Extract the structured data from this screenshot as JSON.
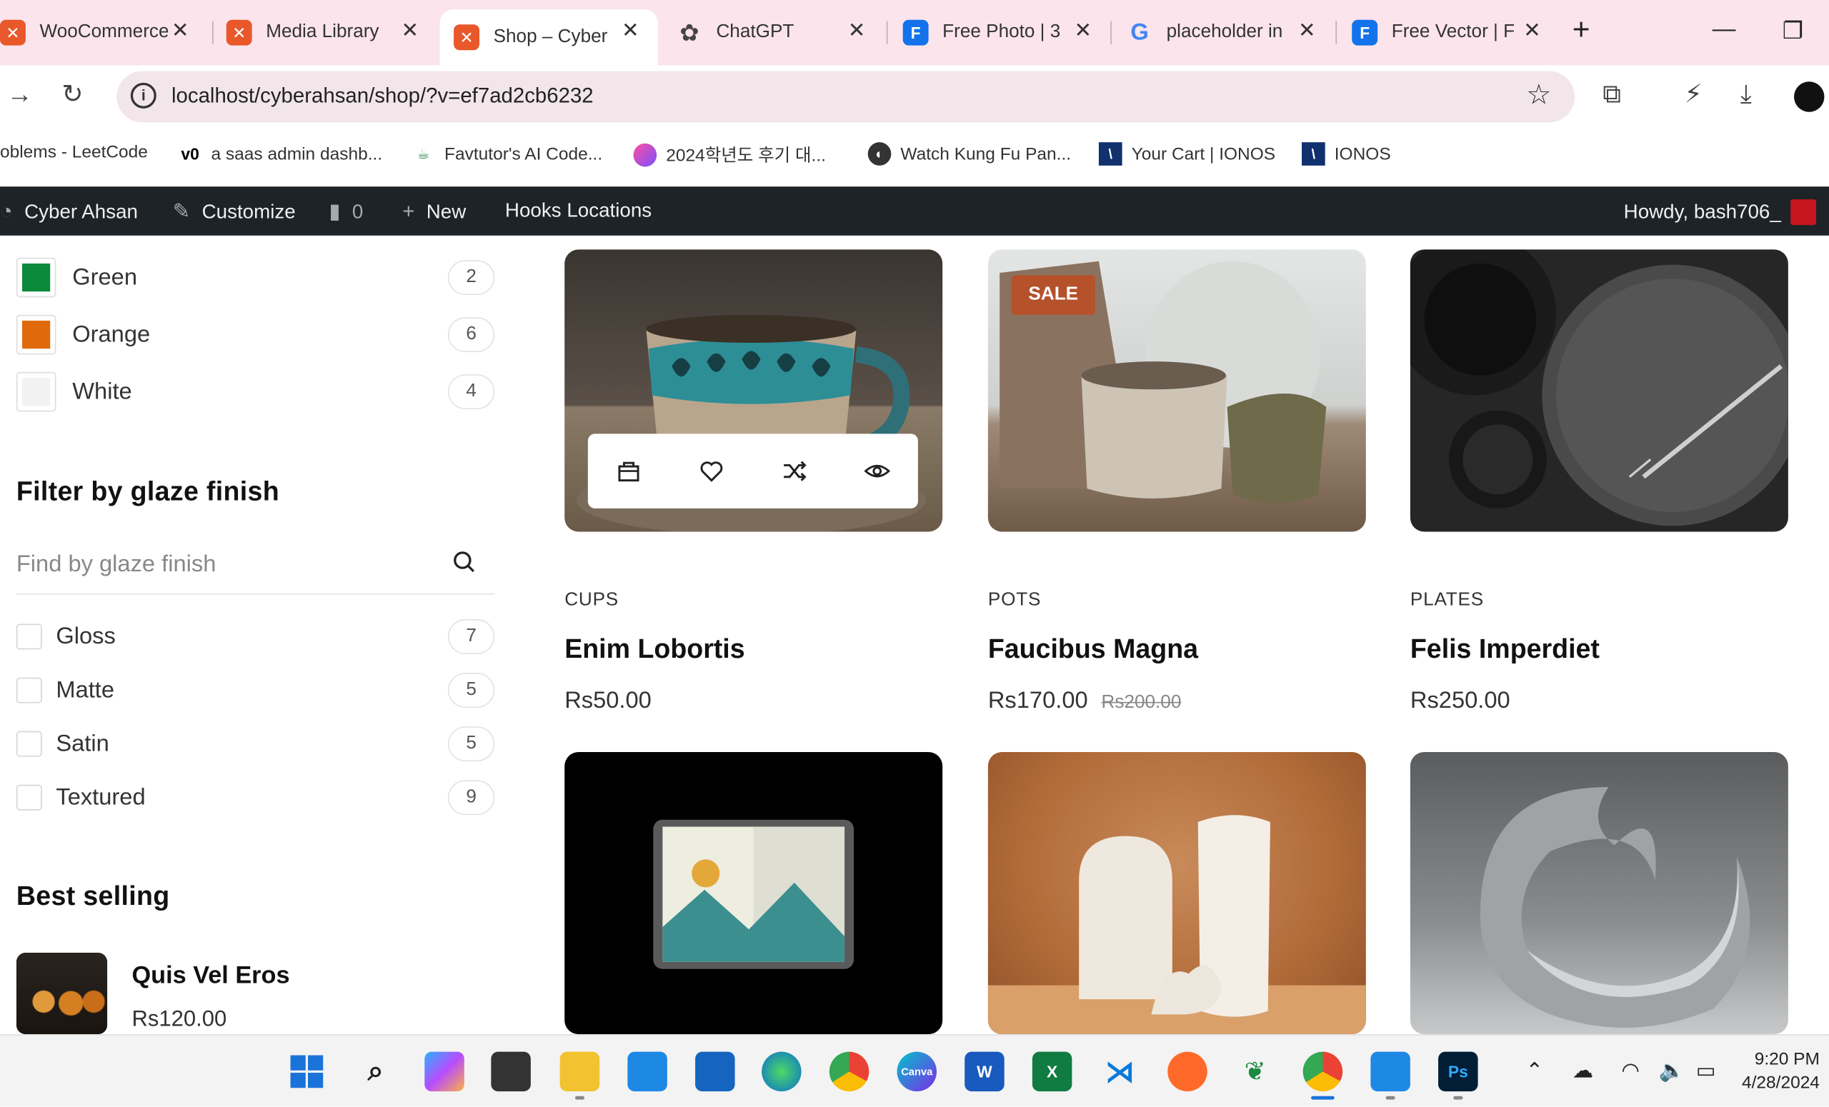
{
  "browser": {
    "tabs": [
      {
        "title": "WooCommerce",
        "favicon": "xampp-icon",
        "color": "#e8582a"
      },
      {
        "title": "Media Library",
        "favicon": "xampp-icon",
        "color": "#e8582a"
      },
      {
        "title": "Shop – Cyber",
        "favicon": "xampp-icon",
        "color": "#e8582a",
        "active": true
      },
      {
        "title": "ChatGPT",
        "favicon": "chatgpt-icon",
        "color": "#444444"
      },
      {
        "title": "Free Photo | 3",
        "favicon": "freepik-icon",
        "color": "#1273eb"
      },
      {
        "title": "placeholder in",
        "favicon": "google-icon",
        "color": "#4285f4"
      },
      {
        "title": "Free Vector | F",
        "favicon": "freepik-icon",
        "color": "#1273eb"
      }
    ],
    "url": "localhost/cyberahsan/shop/?v=ef7ad2cb6232",
    "bookmarks": [
      {
        "label": "oblems - LeetCode",
        "icon": ""
      },
      {
        "label": "a saas admin dashb...",
        "icon": "v0-icon"
      },
      {
        "label": "Favtutor's AI Code...",
        "icon": "favtutor-icon"
      },
      {
        "label": "2024학년도 후기 대...",
        "icon": "circle-icon"
      },
      {
        "label": "Watch Kung Fu Pan...",
        "icon": "globe-icon"
      },
      {
        "label": "Your Cart | IONOS",
        "icon": "ionos-icon"
      },
      {
        "label": "IONOS",
        "icon": "ionos-icon"
      }
    ]
  },
  "adminbar": {
    "site": "Cyber Ahsan",
    "customize": "Customize",
    "comments": "0",
    "new": "New",
    "hooks": "Hooks Locations",
    "howdy": "Howdy, bash706_"
  },
  "sidebar": {
    "colors": [
      {
        "label": "Green",
        "count": "2",
        "hex": "#0a8a3a"
      },
      {
        "label": "Orange",
        "count": "6",
        "hex": "#e06a0b"
      },
      {
        "label": "White",
        "count": "4",
        "hex": "#f2f2f2"
      }
    ],
    "glaze_title": "Filter by glaze finish",
    "glaze_placeholder": "Find by glaze finish",
    "glaze": [
      {
        "label": "Gloss",
        "count": "7"
      },
      {
        "label": "Matte",
        "count": "5"
      },
      {
        "label": "Satin",
        "count": "5"
      },
      {
        "label": "Textured",
        "count": "9"
      }
    ],
    "best_title": "Best selling",
    "best": {
      "name": "Quis Vel Eros",
      "price": "Rs120.00"
    }
  },
  "products": [
    {
      "category": "CUPS",
      "title": "Enim Lobortis",
      "price": "Rs50.00",
      "old_price": ""
    },
    {
      "category": "POTS",
      "title": "Faucibus Magna",
      "price": "Rs170.00",
      "old_price": "Rs200.00",
      "badge": "SALE"
    },
    {
      "category": "PLATES",
      "title": "Felis Imperdiet",
      "price": "Rs250.00",
      "old_price": ""
    }
  ],
  "taskbar": {
    "time": "9:20 PM",
    "date": "4/28/2024"
  }
}
